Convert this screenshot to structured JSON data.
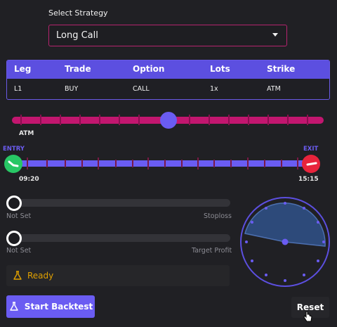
{
  "strategy": {
    "label": "Select Strategy",
    "value": "Long Call"
  },
  "legs_table": {
    "headers": [
      "Leg",
      "Trade",
      "Option",
      "Lots",
      "Strike"
    ],
    "rows": [
      [
        "L1",
        "BUY",
        "CALL",
        "1x",
        "ATM"
      ]
    ]
  },
  "strike_slider": {
    "label": "ATM",
    "color": "#c2166f",
    "knob_color": "#6a5cf2"
  },
  "time_slider": {
    "entry_label": "ENTRY",
    "exit_label": "EXIT",
    "entry_time": "09:20",
    "exit_time": "15:15",
    "entry_color": "#28c765",
    "exit_color": "#e8243c",
    "track_color": "#6a5cf2"
  },
  "stoploss": {
    "left_label": "Not Set",
    "right_label": "Stoploss"
  },
  "target_profit": {
    "left_label": "Not Set",
    "right_label": "Target Profit"
  },
  "status": {
    "text": "Ready",
    "color": "#e0a000"
  },
  "actions": {
    "start_label": "Start Backtest",
    "reset_label": "Reset"
  },
  "icons": {
    "caret": "chevron-down-icon",
    "status": "flask-icon",
    "start": "flask-icon",
    "cursor": "hand-pointer-icon",
    "clock": "clock-dial-icon"
  }
}
